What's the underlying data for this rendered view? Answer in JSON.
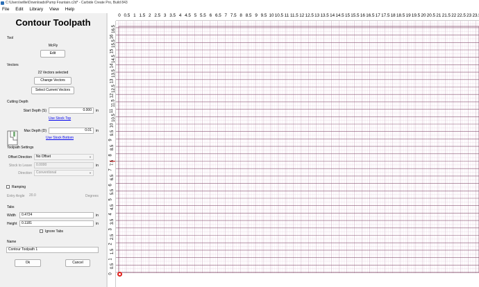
{
  "window": {
    "title": "C:\\Users\\willie\\Downloads\\Pump Fountain.c2d* - Carbide Create Pro, Build 843"
  },
  "menu": [
    "File",
    "Edit",
    "Library",
    "View",
    "Help"
  ],
  "panel": {
    "title": "Contour Toolpath",
    "tool": {
      "section": "Tool",
      "name": "McFly",
      "edit_label": "Edit"
    },
    "vectors": {
      "section": "Vectors",
      "selected_text": "22 Vectors selected",
      "change_label": "Change Vectors",
      "select_current_label": "Select Current Vectors"
    },
    "cutting_depth": {
      "section": "Cutting Depth",
      "start_label": "Start Depth (S)",
      "start_value": "0.000",
      "start_unit": "in",
      "use_stock_top": "Use Stock Top",
      "max_label": "Max Depth (D)",
      "max_value": "0.01",
      "max_unit": "in",
      "use_stock_bottom": "Use Stock Bottom"
    },
    "toolpath_settings": {
      "section": "Toolpath Settings",
      "offset_label": "Offset Direction",
      "offset_value": "No Offset",
      "stock_label": "Stock to Leave",
      "stock_value": "0.0000",
      "stock_unit": "in",
      "direction_label": "Direction",
      "direction_value": "Conventional"
    },
    "ramping": {
      "label": "Ramping",
      "entry_label": "Entry Angle",
      "entry_value": "20.0",
      "entry_unit": "Degrees"
    },
    "tabs": {
      "section": "Tabs",
      "width_label": "Width",
      "width_value": "0.4724",
      "width_unit": "in",
      "height_label": "Height",
      "height_value": "0.1181",
      "height_unit": "in",
      "ignore_label": "Ignore Tabs"
    },
    "name": {
      "section": "Name",
      "value": "Contour Toolpath 1"
    },
    "ok_label": "Ok",
    "cancel_label": "Cancel"
  },
  "ruler": {
    "x_ticks": [
      "0",
      "0.5",
      "1",
      "1.5",
      "2",
      "2.5",
      "3",
      "3.5",
      "4",
      "4.5",
      "5",
      "5.5",
      "6",
      "6.5",
      "7",
      "7.5",
      "8",
      "8.5",
      "9",
      "9.5",
      "10",
      "10.5",
      "11",
      "11.5",
      "12",
      "12.5",
      "13",
      "13.5",
      "14",
      "14.5",
      "15",
      "15.5",
      "16",
      "16.5",
      "17",
      "17.5",
      "18",
      "18.5",
      "19",
      "19.5",
      "20",
      "20.5",
      "21",
      "21.5",
      "22",
      "22.5",
      "23",
      "23.5"
    ],
    "y_ticks": [
      "0",
      "0.5",
      "1",
      "1.5",
      "2",
      "2.5",
      "3",
      "3.5",
      "4",
      "4.5",
      "5",
      "5.5",
      "6",
      "6.5",
      "7",
      "7.5",
      "8",
      "8.5",
      "9",
      "9.5",
      "10",
      "10.5",
      "11",
      "11.5",
      "12",
      "12.5",
      "13",
      "13.5",
      "14",
      "14.5",
      "15",
      "15.5",
      "16",
      "16.5"
    ]
  },
  "colors": {
    "grid_minor": "#f2e6ef",
    "grid_major": "#d9bfd1",
    "stripe": "#7a4060",
    "origin": "#e0201b"
  }
}
